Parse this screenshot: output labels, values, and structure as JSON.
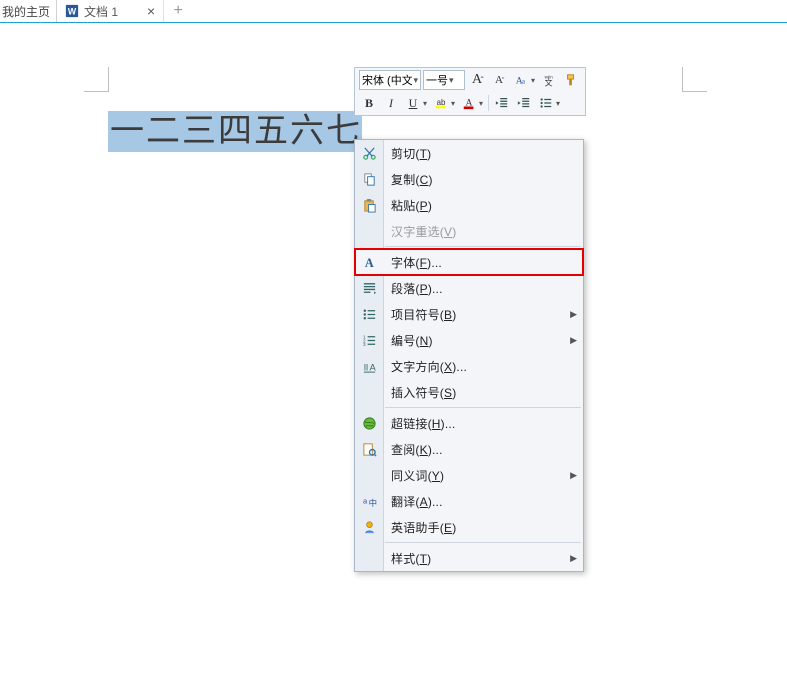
{
  "tabs": {
    "home_label": "我的主页",
    "doc_label": "文档 1",
    "close_glyph": "×",
    "plus_glyph": "+"
  },
  "selection_text": "一二三四五六七",
  "mini_toolbar": {
    "font_name": "宋体 (中文",
    "font_size": "一号",
    "grow_font": "A",
    "shrink_font": "A",
    "bold": "B",
    "italic": "I",
    "underline": "U"
  },
  "context_menu": {
    "items": [
      {
        "id": "cut",
        "label": "剪切(T)",
        "icon": "scissors"
      },
      {
        "id": "copy",
        "label": "复制(C)",
        "icon": "copy"
      },
      {
        "id": "paste",
        "label": "粘贴(P)",
        "icon": "paste"
      },
      {
        "id": "reselect",
        "label": "汉字重选(V)",
        "icon": "",
        "disabled": true
      },
      {
        "sep": true
      },
      {
        "id": "font",
        "label": "字体(F)...",
        "icon": "font-a",
        "highlight": true
      },
      {
        "id": "paragraph",
        "label": "段落(P)...",
        "icon": "paragraph"
      },
      {
        "id": "bullets",
        "label": "项目符号(B)",
        "icon": "bullets",
        "submenu": true
      },
      {
        "id": "numbering",
        "label": "编号(N)",
        "icon": "numbering",
        "submenu": true
      },
      {
        "id": "textdir",
        "label": "文字方向(X)...",
        "icon": "text-direction"
      },
      {
        "id": "symbol",
        "label": "插入符号(S)",
        "icon": ""
      },
      {
        "sep": true
      },
      {
        "id": "hyperlink",
        "label": "超链接(H)...",
        "icon": "globe"
      },
      {
        "id": "review",
        "label": "查阅(K)...",
        "icon": "review"
      },
      {
        "id": "synonym",
        "label": "同义词(Y)",
        "icon": "",
        "submenu": true
      },
      {
        "id": "translate",
        "label": "翻译(A)...",
        "icon": "translate"
      },
      {
        "id": "english",
        "label": "英语助手(E)",
        "icon": "assistant"
      },
      {
        "sep": true
      },
      {
        "id": "style",
        "label": "样式(T)",
        "icon": "",
        "submenu": true
      }
    ]
  }
}
